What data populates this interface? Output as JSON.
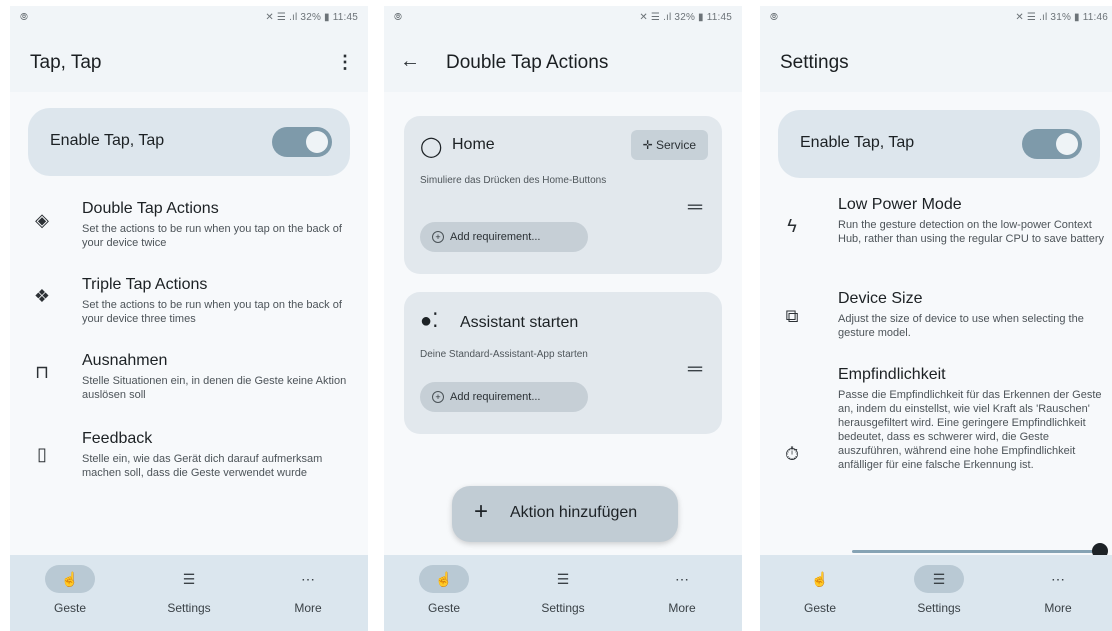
{
  "screens": [
    {
      "status": {
        "left": "⦾",
        "right": "✕ ☰ .ıl 32% ▮ 11:45"
      },
      "title": "Tap, Tap",
      "enable_label": "Enable Tap, Tap",
      "items": [
        {
          "title": "Double Tap Actions",
          "sub": "Set the actions to be run when you tap on the back of your device twice"
        },
        {
          "title": "Triple Tap Actions",
          "sub": "Set the actions to be run when you tap on the back of your device three times"
        },
        {
          "title": "Ausnahmen",
          "sub": "Stelle Situationen ein, in denen die Geste keine Aktion auslösen soll"
        },
        {
          "title": "Feedback",
          "sub": "Stelle ein, wie das Gerät dich darauf aufmerksam machen soll, dass die Geste verwendet wurde"
        }
      ],
      "nav": [
        "Geste",
        "Settings",
        "More"
      ]
    },
    {
      "status": {
        "left": "⦾",
        "right": "✕ ☰ .ıl 32% ▮ 11:45"
      },
      "title": "Double Tap Actions",
      "actions": [
        {
          "title": "Home",
          "sub": "Simuliere das Drücken des Home-Buttons",
          "chip": "Service",
          "req": "Add requirement..."
        },
        {
          "title": "Assistant starten",
          "sub": "Deine Standard-Assistant-App starten",
          "req": "Add requirement..."
        }
      ],
      "fab_label": "Aktion hinzufügen",
      "nav": [
        "Geste",
        "Settings",
        "More"
      ]
    },
    {
      "status": {
        "left": "⦾",
        "right": "✕ ☰ .ıl 31% ▮ 11:46"
      },
      "title": "Settings",
      "enable_label": "Enable Tap, Tap",
      "items": [
        {
          "title": "Low Power Mode",
          "sub": "Run the gesture detection on the low-power Context Hub, rather than using the regular CPU to save battery"
        },
        {
          "title": "Device Size",
          "sub": "Adjust the size of device to use when selecting the gesture model."
        },
        {
          "title": "Empfindlichkeit",
          "sub": "Passe die Empfindlichkeit für das Erkennen der Geste an, indem du einstellst, wie viel Kraft als 'Rauschen' herausgefiltert wird. Eine geringere Empfindlichkeit bedeutet, dass es schwerer wird, die Geste auszuführen, während eine hohe Empfindlichkeit anfälliger für eine falsche Erkennung ist."
        }
      ],
      "sensitivity_level": 1.0,
      "nav": [
        "Geste",
        "Settings",
        "More"
      ]
    }
  ]
}
